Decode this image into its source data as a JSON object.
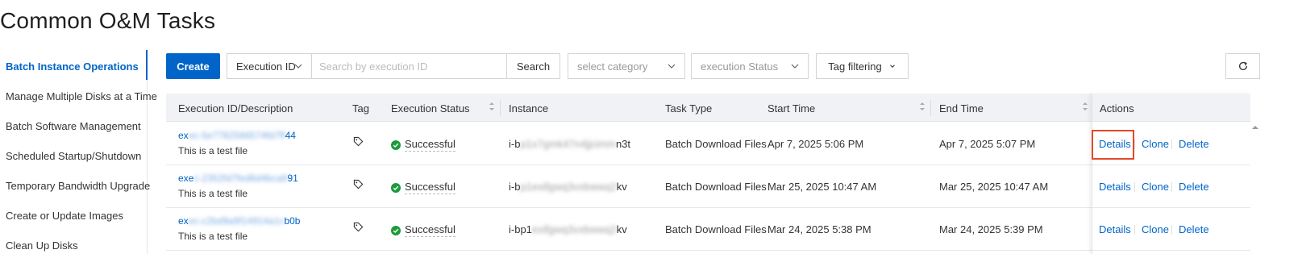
{
  "page": {
    "title": "Common O&M Tasks"
  },
  "sidebar": {
    "items": [
      {
        "label": "Batch Instance Operations",
        "active": true
      },
      {
        "label": "Manage Multiple Disks at a Time",
        "active": false
      },
      {
        "label": "Batch Software Management",
        "active": false
      },
      {
        "label": "Scheduled Startup/Shutdown",
        "active": false
      },
      {
        "label": "Temporary Bandwidth Upgrade",
        "active": false
      },
      {
        "label": "Create or Update Images",
        "active": false
      },
      {
        "label": "Clean Up Disks",
        "active": false
      }
    ]
  },
  "toolbar": {
    "create_label": "Create",
    "filter_field": "Execution ID",
    "search_placeholder": "Search by execution ID",
    "search_label": "Search",
    "category_placeholder": "select category",
    "status_placeholder": "execution Status",
    "tag_filter_label": "Tag filtering",
    "refresh_icon": "refresh-icon"
  },
  "table": {
    "columns": {
      "execution_id": "Execution ID/Description",
      "tag": "Tag",
      "status": "Execution Status",
      "instance": "Instance",
      "task_type": "Task Type",
      "start_time": "Start Time",
      "end_time": "End Time",
      "actions": "Actions"
    },
    "rows": [
      {
        "id_prefix": "ex",
        "id_hidden": "ec-5e7782566574fd7ff",
        "id_suffix": "44",
        "description": "This is a test file",
        "status": "Successful",
        "instance_prefix": "i-b",
        "instance_hidden": "p1x7gmk47n4jjcimm",
        "instance_suffix": "n3t",
        "task_type": "Batch Download Files",
        "start_time": "Apr 7, 2025 5:06 PM",
        "end_time": "Apr 7, 2025 5:07 PM",
        "actions": [
          "Details",
          "Clone",
          "Delete"
        ]
      },
      {
        "id_prefix": "exe",
        "id_hidden": "c-2352fd7fed6d4bca8",
        "id_suffix": "91",
        "description": "This is a test file",
        "status": "Successful",
        "instance_prefix": "i-b",
        "instance_hidden": "p1exifgwq3vxbwwq2",
        "instance_suffix": "kv",
        "task_type": "Batch Download Files",
        "start_time": "Mar 25, 2025 10:47 AM",
        "end_time": "Mar 25, 2025 10:47 AM",
        "actions": [
          "Details",
          "Clone",
          "Delete"
        ]
      },
      {
        "id_prefix": "ex",
        "id_hidden": "ec-c2bd9a9f14914a1c",
        "id_suffix": "b0b",
        "description": "This is a test file",
        "status": "Successful",
        "instance_prefix": "i-bp1",
        "instance_hidden": "exifgwq3vxbwwq2",
        "instance_suffix": "kv",
        "task_type": "Batch Download Files",
        "start_time": "Mar 24, 2025 5:38 PM",
        "end_time": "Mar 24, 2025 5:39 PM",
        "actions": [
          "Details",
          "Clone",
          "Delete"
        ]
      }
    ]
  },
  "colors": {
    "accent": "#0064c8",
    "success": "#1e9a3c",
    "highlight": "#e2492b"
  }
}
